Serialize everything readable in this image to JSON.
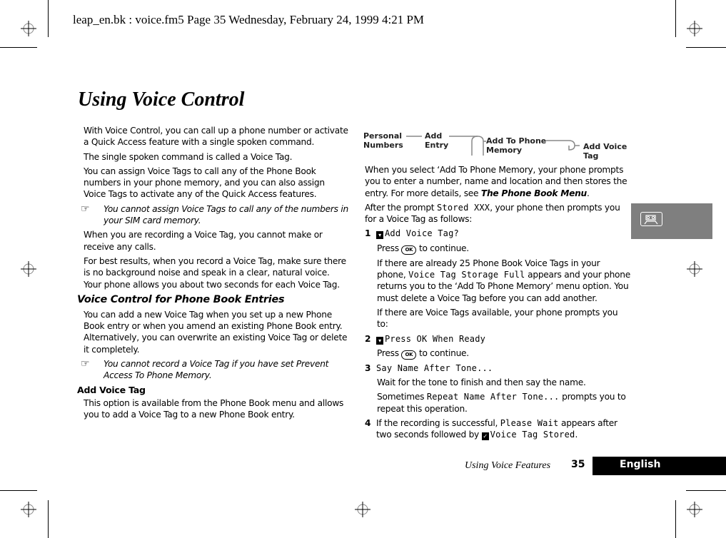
{
  "header": {
    "print_line": "leap_en.bk : voice.fm5  Page 35  Wednesday, February 24, 1999  4:21 PM"
  },
  "page": {
    "title": "Using Voice Control"
  },
  "menu_path": {
    "nodes": [
      "Personal Numbers",
      "Add Entry",
      "Add To Phone Memory",
      "Add Voice Tag"
    ],
    "labels": {
      "n1a": "Personal",
      "n1b": "Numbers",
      "n2a": "Add",
      "n2b": "Entry",
      "n3a": "Add To Phone",
      "n3b": "Memory",
      "n4a": "Add Voice",
      "n4b": "Tag"
    }
  },
  "left_column": {
    "p1": "With Voice Control, you can call up a phone number or activate a Quick Access feature with a single spoken command.",
    "p2": "The single spoken command is called a Voice Tag.",
    "p3": "You can assign Voice Tags to call any of the Phone Book numbers in your phone memory, and you can also assign Voice Tags to activate any of the Quick Access features.",
    "note1": "You cannot assign Voice Tags to call any of the numbers in your SIM card memory.",
    "p4": "When you are recording a Voice Tag, you cannot make or receive any calls.",
    "p5": "For best results, when you record a Voice Tag, make sure there is no background noise and speak in a clear, natural voice. Your phone allows you about two seconds for each Voice Tag.",
    "h2": "Voice Control for Phone Book Entries",
    "p6": "You can add a new Voice Tag when you set up a new Phone Book entry or when you amend an existing Phone Book entry. Alternatively, you can overwrite an existing Voice Tag or delete it completely.",
    "note2": "You cannot record a Voice Tag if you have set Prevent Access To Phone Memory.",
    "h3": "Add Voice Tag",
    "p7": "This option is available from the Phone Book menu and allows you to add a Voice Tag to a new Phone Book entry."
  },
  "right_column": {
    "p1_pre": "When you select ‘Add To Phone Memory, your phone prompts you to enter a number, name and location and then stores the entry. For more details, see ",
    "p1_link": "The Phone Book Menu",
    "p1_post": ".",
    "p2_pre": "After the prompt ",
    "p2_code": "Stored XXX",
    "p2_post": ", your phone then prompts you for a Voice Tag as follows:",
    "steps": [
      {
        "num": "1",
        "display": "Add Voice Tag?",
        "press_pre": "Press ",
        "ok": "OK",
        "press_post": " to continue.",
        "text_a_pre": "If there are already 25 Phone Book Voice Tags in your phone, ",
        "text_a_code": "Voice Tag Storage Full",
        "text_a_post": " appears and your phone returns you to the ‘Add To Phone Memory’ menu option. You must delete a Voice Tag before you can add another.",
        "text_b": "If there are Voice Tags available, your phone prompts you to:"
      },
      {
        "num": "2",
        "display": "Press OK When Ready",
        "press_pre": "Press ",
        "ok": "OK",
        "press_post": " to continue."
      },
      {
        "num": "3",
        "display": "Say Name After Tone...",
        "text_a": "Wait for the tone to finish and then say the name.",
        "text_b_pre": "Sometimes ",
        "text_b_code": "Repeat Name After Tone...",
        "text_b_post": " prompts you to repeat this operation."
      },
      {
        "num": "4",
        "text_pre": "If the recording is successful, ",
        "text_code1": "Please Wait",
        "text_mid": " appears after two seconds followed by ",
        "text_code2": "Voice Tag Stored",
        "text_post": "."
      }
    ]
  },
  "side_tab": {
    "icon": "cassette-icon",
    "color": "#7f7f7f"
  },
  "footer": {
    "section": "Using Voice Features",
    "page_number": "35",
    "language": "English"
  },
  "icons": {
    "note": "☞",
    "display_icon": "▾",
    "check_icon": "✓"
  }
}
